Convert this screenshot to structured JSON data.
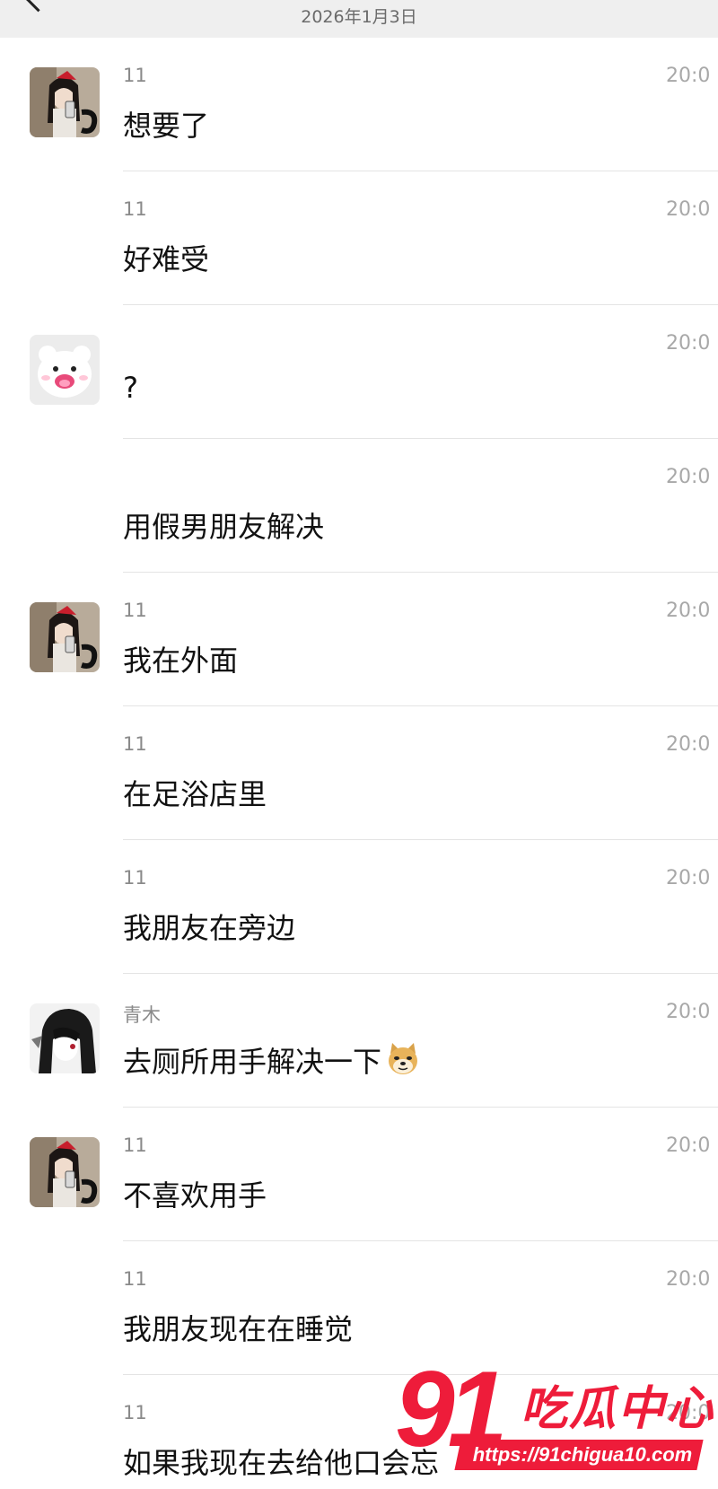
{
  "header": {
    "date": "2026年1月3日"
  },
  "messages": [
    {
      "sender": "11",
      "text": "想要了",
      "time": "20:0",
      "avatar": "girl-avatar"
    },
    {
      "sender": "11",
      "text": "好难受",
      "time": "20:0",
      "avatar": ""
    },
    {
      "sender": "",
      "text": "?",
      "time": "20:0",
      "avatar": "white-bear-avatar"
    },
    {
      "sender": "",
      "text": "用假男朋友解决",
      "time": "20:0",
      "avatar": ""
    },
    {
      "sender": "11",
      "text": "我在外面",
      "time": "20:0",
      "avatar": "girl-avatar"
    },
    {
      "sender": "11",
      "text": "在足浴店里",
      "time": "20:0",
      "avatar": ""
    },
    {
      "sender": "11",
      "text": "我朋友在旁边",
      "time": "20:0",
      "avatar": ""
    },
    {
      "sender": "青木",
      "text": "去厕所用手解决一下",
      "time": "20:0",
      "avatar": "anime-avatar",
      "emoji": "doge-emoji"
    },
    {
      "sender": "11",
      "text": "不喜欢用手",
      "time": "20:0",
      "avatar": "girl-avatar"
    },
    {
      "sender": "11",
      "text": "我朋友现在在睡觉",
      "time": "20:0",
      "avatar": ""
    },
    {
      "sender": "11",
      "text": "如果我现在去给他口会忘",
      "time": "20:0",
      "avatar": ""
    }
  ],
  "watermark": {
    "number": "91",
    "title": "吃瓜中心",
    "url": "https://91chigua10.com"
  },
  "colors": {
    "watermark": "#ee1c3a",
    "header_bg": "#efefef",
    "divider": "#e4e4e4"
  }
}
